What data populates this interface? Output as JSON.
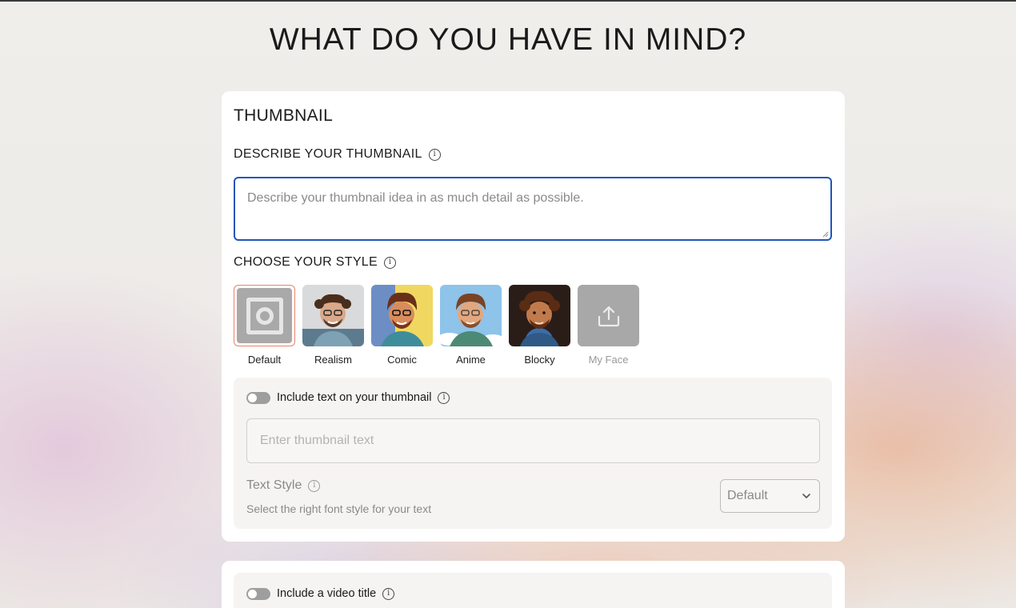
{
  "page": {
    "title": "WHAT DO YOU HAVE IN MIND?"
  },
  "thumbnail_card": {
    "section_title": "THUMBNAIL",
    "describe_label": "DESCRIBE YOUR THUMBNAIL",
    "describe_placeholder": "Describe your thumbnail idea in as much detail as possible.",
    "style_label": "CHOOSE YOUR STYLE",
    "styles": [
      {
        "label": "Default",
        "selected": true
      },
      {
        "label": "Realism"
      },
      {
        "label": "Comic"
      },
      {
        "label": "Anime"
      },
      {
        "label": "Blocky"
      },
      {
        "label": "My Face",
        "disabled": true
      }
    ],
    "include_text_label": "Include text on your thumbnail",
    "include_text_enabled": false,
    "text_placeholder": "Enter thumbnail text",
    "text_style_label": "Text Style",
    "text_style_sub": "Select the right font style for your text",
    "text_style_value": "Default"
  },
  "video_title_card": {
    "include_title_label": "Include a video title",
    "include_title_enabled": false
  },
  "colors": {
    "accent_border": "#1f56b8",
    "selected_border": "#e9836a",
    "toggle_off": "#9e9e9e"
  }
}
